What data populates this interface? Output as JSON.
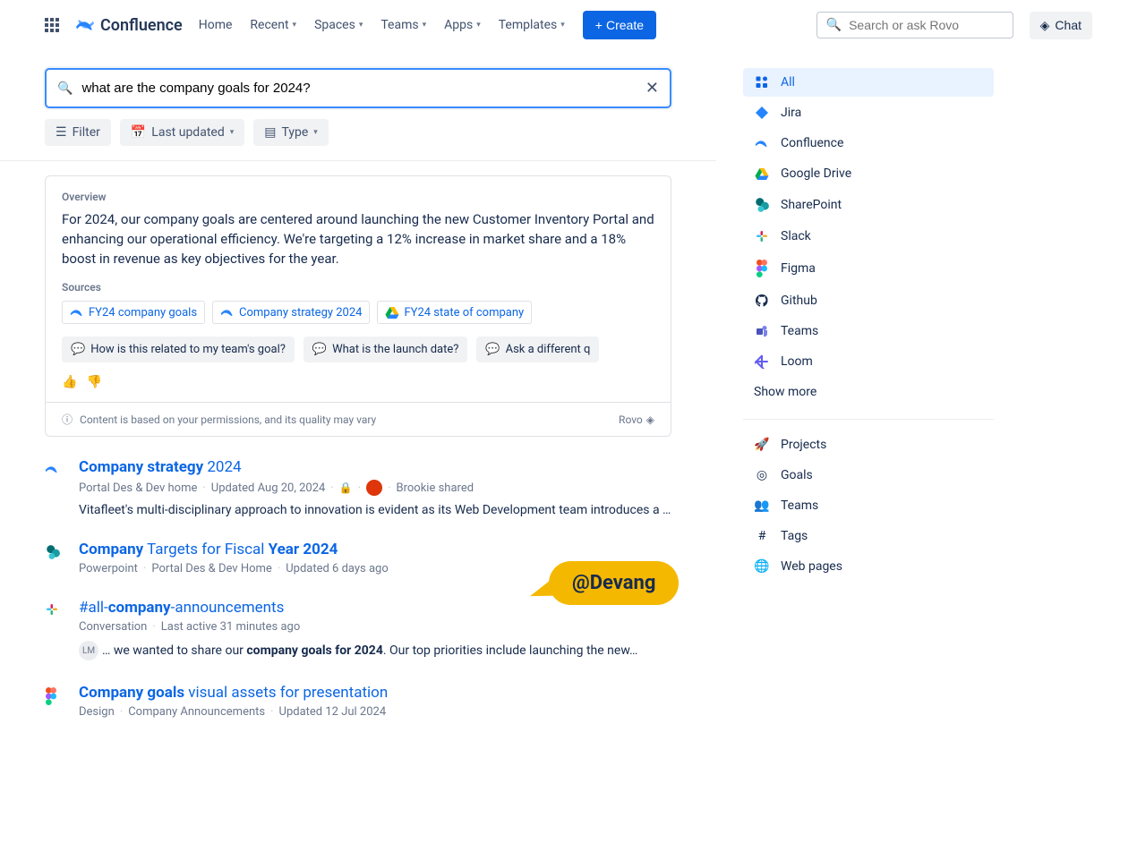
{
  "nav": {
    "product": "Confluence",
    "home": "Home",
    "recent": "Recent",
    "spaces": "Spaces",
    "teams": "Teams",
    "apps": "Apps",
    "templates": "Templates",
    "create": "Create",
    "search_placeholder": "Search or ask Rovo",
    "chat": "Chat"
  },
  "search": {
    "query": "what are the company goals for 2024?",
    "filters": {
      "filter": "Filter",
      "last_updated": "Last updated",
      "type": "Type"
    }
  },
  "ai": {
    "overview_label": "Overview",
    "text": "For 2024, our company goals are centered around launching the new Customer Inventory Portal and enhancing our operational efficiency. We're targeting a 12% increase in market share and a 18% boost in revenue as key objectives for the year.",
    "sources_label": "Sources",
    "sources": [
      {
        "label": "FY24 company goals",
        "icon": "confluence"
      },
      {
        "label": "Company strategy 2024",
        "icon": "confluence"
      },
      {
        "label": "FY24 state of company",
        "icon": "gdrive"
      }
    ],
    "suggestions": [
      "How is this related to my team's goal?",
      "What is the launch date?",
      "Ask a different q"
    ],
    "disclaimer": "Content is based on your permissions, and its quality may vary",
    "rovo": "Rovo"
  },
  "cursor_user": "@Devang",
  "results": [
    {
      "icon": "confluence",
      "title_html": "<b>Company strategy</b> 2024",
      "meta": [
        "Portal Des & Dev home",
        "Updated Aug 20, 2024",
        "lock",
        "avatar",
        "Brookie shared"
      ],
      "snippet": "Vitafleet's multi-disciplinary approach to innovation is evident as its Web Development team introduces a ne…"
    },
    {
      "icon": "sharepoint",
      "title_html": "<b>Company</b> Targets for Fiscal <b>Year 2024</b>",
      "meta": [
        "Powerpoint",
        "Portal Des & Dev Home",
        "Updated 6 days ago"
      ]
    },
    {
      "icon": "slack",
      "title_html": "#all-<b>company</b>-announcements",
      "meta": [
        "Conversation",
        "Last active 31 minutes ago"
      ],
      "inline_avatar": "LM",
      "inline_html": "… we wanted to share our <b>company goals for 2024</b>. Our top priorities include launching the new…"
    },
    {
      "icon": "figma",
      "title_html": "<b>Company goals</b> visual assets for presentation",
      "meta": [
        "Design",
        "Company Announcements",
        "Updated 12 Jul 2024"
      ]
    }
  ],
  "sidebar": {
    "sources": [
      {
        "label": "All",
        "icon": "all",
        "active": true
      },
      {
        "label": "Jira",
        "icon": "jira"
      },
      {
        "label": "Confluence",
        "icon": "confluence"
      },
      {
        "label": "Google Drive",
        "icon": "gdrive"
      },
      {
        "label": "SharePoint",
        "icon": "sharepoint"
      },
      {
        "label": "Slack",
        "icon": "slack"
      },
      {
        "label": "Figma",
        "icon": "figma"
      },
      {
        "label": "Github",
        "icon": "github"
      },
      {
        "label": "Teams",
        "icon": "teams"
      },
      {
        "label": "Loom",
        "icon": "loom"
      }
    ],
    "show_more": "Show more",
    "nav": [
      {
        "label": "Projects",
        "icon": "🚀"
      },
      {
        "label": "Goals",
        "icon": "◎"
      },
      {
        "label": "Teams",
        "icon": "👥"
      },
      {
        "label": "Tags",
        "icon": "#"
      },
      {
        "label": "Web pages",
        "icon": "🌐"
      }
    ]
  }
}
